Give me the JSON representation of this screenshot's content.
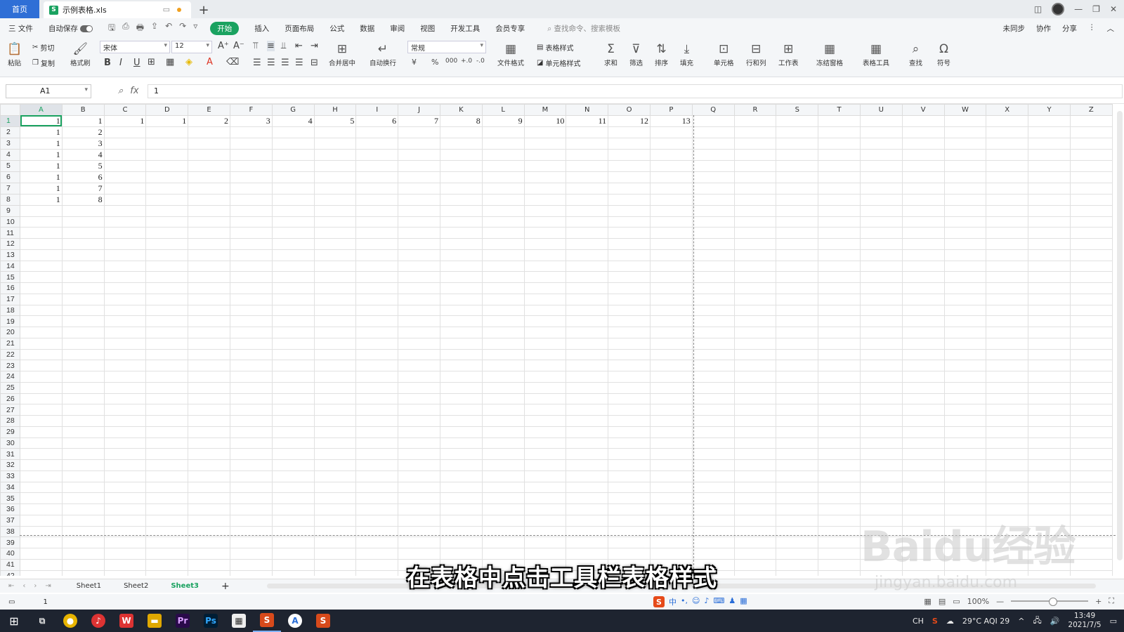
{
  "titlebar": {
    "home_tab": "首页",
    "doc_tab": "示例表格.xls",
    "new_tab": "+"
  },
  "menubar": {
    "file": "三 文件",
    "autosave": "自动保存",
    "tabs": [
      "开始",
      "插入",
      "页面布局",
      "公式",
      "数据",
      "审阅",
      "视图",
      "开发工具",
      "会员专享"
    ],
    "search_placeholder": "查找命令、搜索模板",
    "right": [
      "未同步",
      "协作",
      "分享"
    ]
  },
  "ribbon": {
    "paste": "粘贴",
    "cut": "剪切",
    "copy": "复制",
    "format_painter": "格式刷",
    "font_name": "宋体",
    "font_size": "12",
    "merge_center": "合并居中",
    "wrap_text": "自动换行",
    "number_format": "常规",
    "convert_format": "文件格式",
    "table_style": "表格样式",
    "cell_style": "单元格样式",
    "sum": "求和",
    "filter": "筛选",
    "sort": "排序",
    "fill": "填充",
    "cells": "单元格",
    "rows_cols": "行和列",
    "worksheet": "工作表",
    "freeze": "冻结窗格",
    "table_tools": "表格工具",
    "find": "查找",
    "symbol": "符号"
  },
  "formula_bar": {
    "name_box": "A1",
    "fx": "fx",
    "value": "1"
  },
  "grid": {
    "columns": [
      "A",
      "B",
      "C",
      "D",
      "E",
      "F",
      "G",
      "H",
      "I",
      "J",
      "K",
      "L",
      "M",
      "N",
      "O",
      "P",
      "Q",
      "R",
      "S",
      "T",
      "U",
      "V",
      "W",
      "X",
      "Y",
      "Z"
    ],
    "row_count": 42,
    "cells": [
      [
        "1",
        "1",
        "1",
        "1",
        "2",
        "3",
        "4",
        "5",
        "6",
        "7",
        "8",
        "9",
        "10",
        "11",
        "12",
        "13"
      ],
      [
        "1",
        "2"
      ],
      [
        "1",
        "3"
      ],
      [
        "1",
        "4"
      ],
      [
        "1",
        "5"
      ],
      [
        "1",
        "6"
      ],
      [
        "1",
        "7"
      ],
      [
        "1",
        "8"
      ]
    ]
  },
  "sheets": [
    "Sheet1",
    "Sheet2",
    "Sheet3"
  ],
  "active_sheet": "Sheet3",
  "statusbar": {
    "value": "1",
    "zoom": "100%"
  },
  "taskbar": {
    "weather": "29°C AQI 29",
    "time": "13:49",
    "date": "2021/7/5",
    "lang": "CH"
  },
  "subtitle": "在表格中点击工具栏表格样式",
  "watermark": {
    "brand": "Baidu经验",
    "url": "jingyan.baidu.com"
  }
}
